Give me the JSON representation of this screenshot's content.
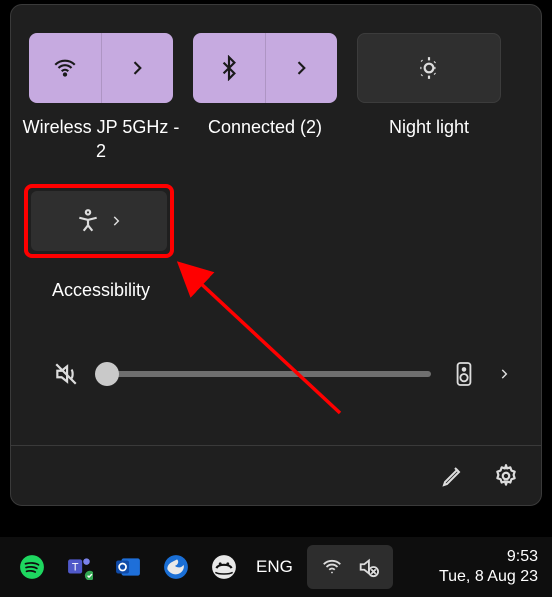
{
  "tiles": {
    "wifi": {
      "label": "Wireless JP 5GHz - 2"
    },
    "bluetooth": {
      "label": "Connected (2)"
    },
    "nightlight": {
      "label": "Night light"
    },
    "accessibility": {
      "label": "Accessibility"
    }
  },
  "volume": {
    "value": 0
  },
  "taskbar": {
    "language": "ENG",
    "time": "9:53",
    "date": "Tue, 8 Aug 23"
  }
}
